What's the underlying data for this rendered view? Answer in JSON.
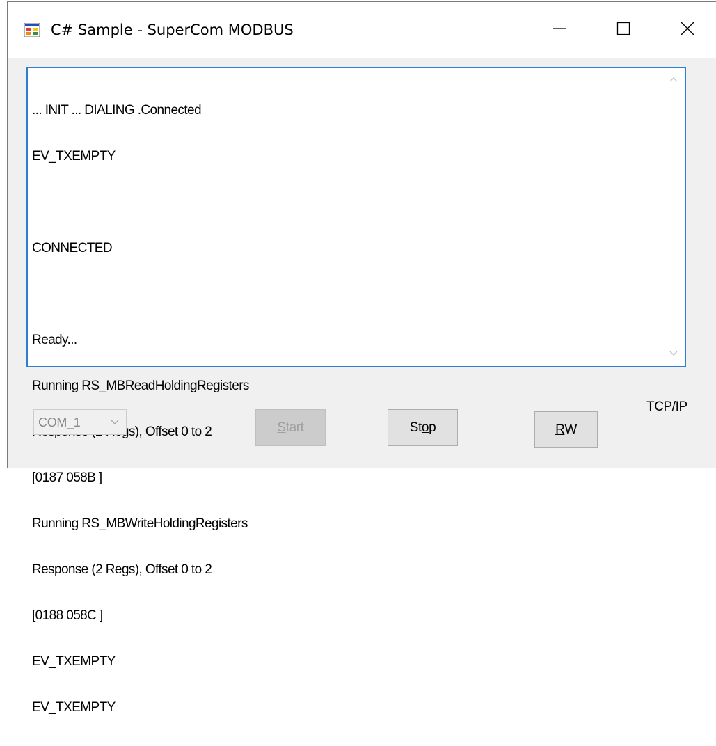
{
  "window": {
    "title": "C# Sample - SuperCom MODBUS"
  },
  "log": {
    "lines": [
      "... INIT ... DIALING .Connected",
      "EV_TXEMPTY",
      "",
      "CONNECTED",
      "",
      "Ready...",
      "Running RS_MBReadHoldingRegisters",
      "Response (2 Regs), Offset 0 to 2",
      "[0187 058B ]",
      "Running RS_MBWriteHoldingRegisters",
      "Response (2 Regs), Offset 0 to 2",
      "[0188 058C ]",
      "EV_TXEMPTY",
      "EV_TXEMPTY"
    ]
  },
  "controls": {
    "port_value": "COM_1",
    "start": {
      "pre": "",
      "mnemonic": "S",
      "post": "tart"
    },
    "stop": {
      "pre": "St",
      "mnemonic": "o",
      "post": "p"
    },
    "rw": {
      "pre": "",
      "mnemonic": "R",
      "post": "W"
    },
    "protocol": "TCP/IP"
  },
  "colors": {
    "focus_border": "#2f7fd1",
    "window_bg": "#f0f0f0"
  }
}
